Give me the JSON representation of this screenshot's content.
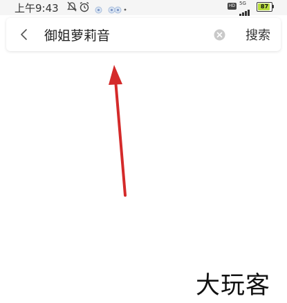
{
  "status_bar": {
    "time": "上午9:43",
    "hd_label": "HD",
    "network_label": "5G",
    "battery_level": 87,
    "battery_text": "87",
    "battery_color": "#b8dd3c"
  },
  "search": {
    "query": "御姐萝莉音",
    "button_label": "搜索",
    "icons": {
      "back": "chevron-left-icon",
      "clear": "clear-circle-icon"
    }
  },
  "annotation": {
    "arrow_color": "#d42a2a"
  },
  "watermark": {
    "text": "大玩客"
  }
}
